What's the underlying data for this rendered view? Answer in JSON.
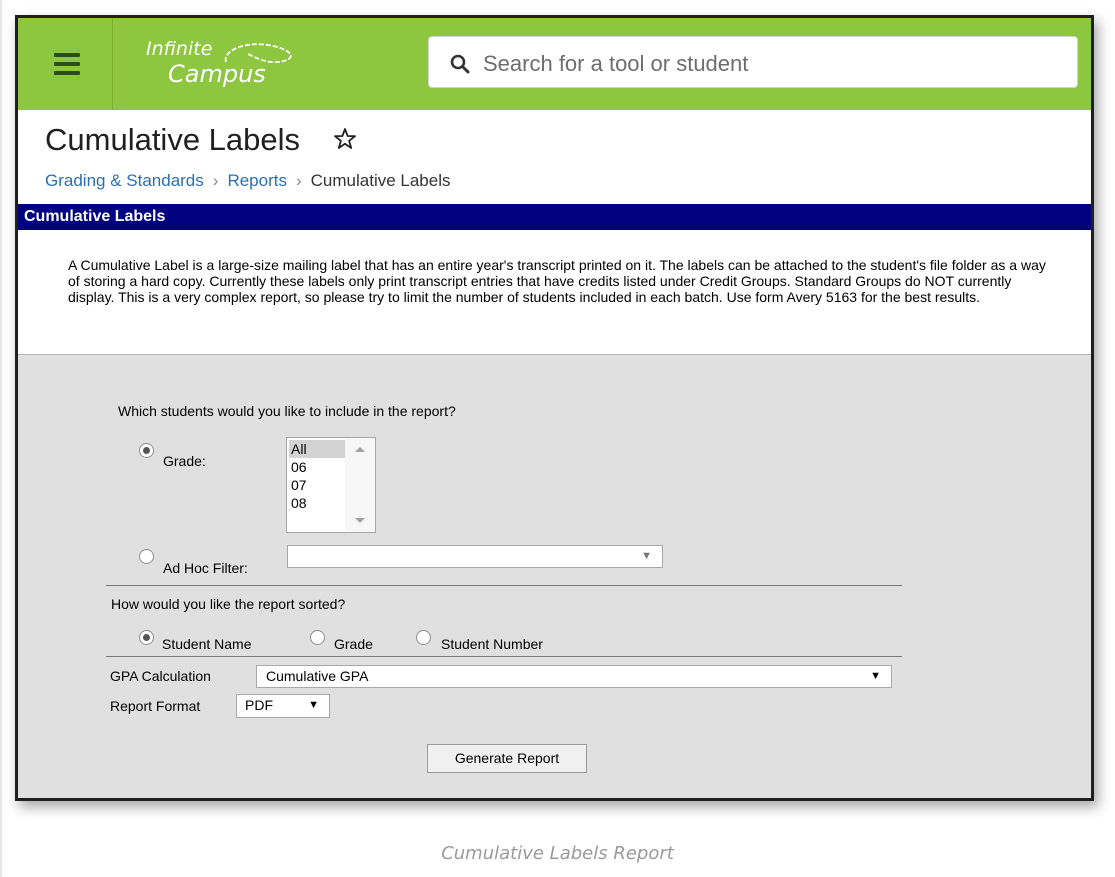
{
  "header": {
    "logo_line1": "Infinite",
    "logo_line2": "Campus",
    "search_placeholder": "Search for a tool or student"
  },
  "page": {
    "title": "Cumulative Labels",
    "breadcrumb": [
      "Grading & Standards",
      "Reports",
      "Cumulative Labels"
    ]
  },
  "section": {
    "title": "Cumulative Labels",
    "description": "A Cumulative Label is a large-size mailing label that has an entire year's transcript printed on it. The labels can be attached to the student's file folder as a way of storing a hard copy. Currently these labels only print transcript entries that have credits listed under Credit Groups. Standard Groups do NOT currently display. This is a very complex report, so please try to limit the number of students included in each batch. Use form Avery 5163 for the best results."
  },
  "form": {
    "students_question": "Which students would you like to include in the report?",
    "grade_label": "Grade:",
    "grade_options": [
      "All",
      "06",
      "07",
      "08"
    ],
    "grade_selected": "All",
    "adhoc_label": "Ad Hoc Filter:",
    "adhoc_value": "",
    "sort_question": "How would you like the report sorted?",
    "sort_options": [
      "Student Name",
      "Grade",
      "Student Number"
    ],
    "sort_selected": "Student Name",
    "gpa_label": "GPA Calculation",
    "gpa_value": "Cumulative GPA",
    "format_label": "Report Format",
    "format_value": "PDF",
    "generate_label": "Generate Report"
  },
  "caption": "Cumulative Labels Report",
  "colors": {
    "header_green": "#8dc63f",
    "section_navy": "#000080",
    "link_blue": "#2b6fb0",
    "panel_gray": "#e0e0e0"
  }
}
